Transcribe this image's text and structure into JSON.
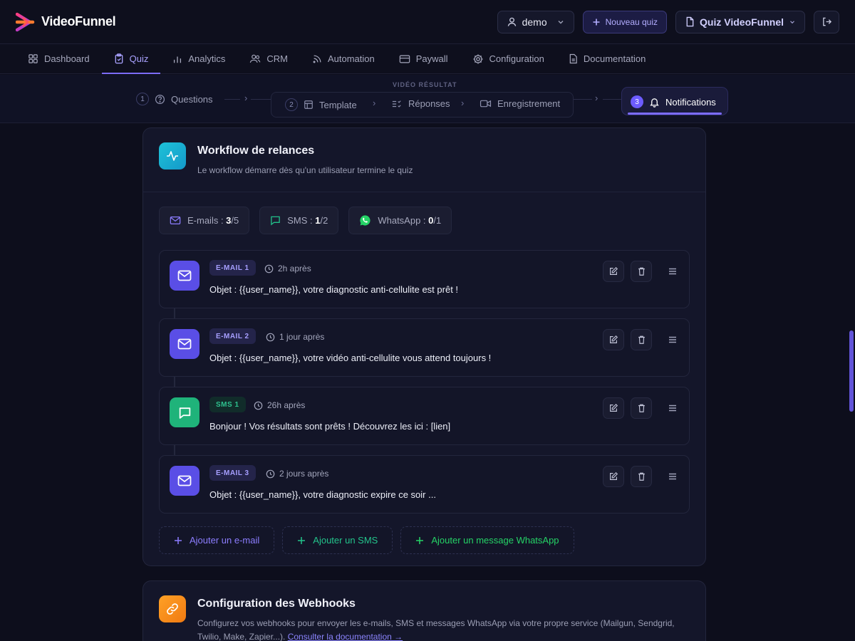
{
  "app": {
    "name": "VideoFunnel"
  },
  "header": {
    "user_label": "demo",
    "new_quiz_label": "Nouveau quiz",
    "quiz_label": "Quiz VideoFunnel"
  },
  "nav": {
    "items": [
      {
        "label": "Dashboard",
        "icon": "grid-icon"
      },
      {
        "label": "Quiz",
        "icon": "clipboard-icon",
        "active": true
      },
      {
        "label": "Analytics",
        "icon": "bar-chart-icon"
      },
      {
        "label": "CRM",
        "icon": "users-icon"
      },
      {
        "label": "Automation",
        "icon": "rss-icon"
      },
      {
        "label": "Paywall",
        "icon": "credit-card-icon"
      },
      {
        "label": "Configuration",
        "icon": "gear-icon"
      },
      {
        "label": "Documentation",
        "icon": "document-icon"
      }
    ]
  },
  "stepper": {
    "step1_num": "1",
    "step1_label": "Questions",
    "group_label": "VIDÉO RÉSULTAT",
    "step2_num": "2",
    "step2_label": "Template",
    "sub_responses": "Réponses",
    "sub_recording": "Enregistrement",
    "step3_num": "3",
    "step3_label": "Notifications"
  },
  "workflow": {
    "title": "Workflow de relances",
    "subtitle": "Le workflow démarre dès qu'un utilisateur termine le quiz",
    "counters": {
      "email_label": "E-mails : ",
      "email_used": "3",
      "email_total": "/5",
      "sms_label": "SMS : ",
      "sms_used": "1",
      "sms_total": "/2",
      "whatsapp_label": "WhatsApp : ",
      "whatsapp_used": "0",
      "whatsapp_total": "/1"
    },
    "messages": [
      {
        "type": "email",
        "badge": "E-MAIL 1",
        "delay": "2h après",
        "subject": "Objet : {{user_name}}, votre diagnostic anti-cellulite est prêt !"
      },
      {
        "type": "email",
        "badge": "E-MAIL 2",
        "delay": "1 jour après",
        "subject": "Objet : {{user_name}}, votre vidéo anti-cellulite vous attend toujours !"
      },
      {
        "type": "sms",
        "badge": "SMS 1",
        "delay": "26h après",
        "subject": "Bonjour ! Vos résultats sont prêts ! Découvrez les ici : [lien]"
      },
      {
        "type": "email",
        "badge": "E-MAIL 3",
        "delay": "2 jours après",
        "subject": "Objet : {{user_name}}, votre diagnostic expire ce soir ..."
      }
    ],
    "add_email": "Ajouter un e-mail",
    "add_sms": "Ajouter un SMS",
    "add_whatsapp": "Ajouter un message WhatsApp"
  },
  "webhooks": {
    "title": "Configuration des Webhooks",
    "description": "Configurez vos webhooks pour envoyer les e-mails, SMS et messages WhatsApp via votre propre service (Mailgun, Sendgrid, Twilio, Make, Zapier...).",
    "doc_link": "Consulter la documentation →"
  },
  "colors": {
    "accent": "#7c6cff",
    "email": "#5b4fe0",
    "sms": "#1fb37a",
    "whatsapp": "#25d366",
    "webhook": "#f28c1c",
    "workflow_icon": "#19b3d3"
  }
}
